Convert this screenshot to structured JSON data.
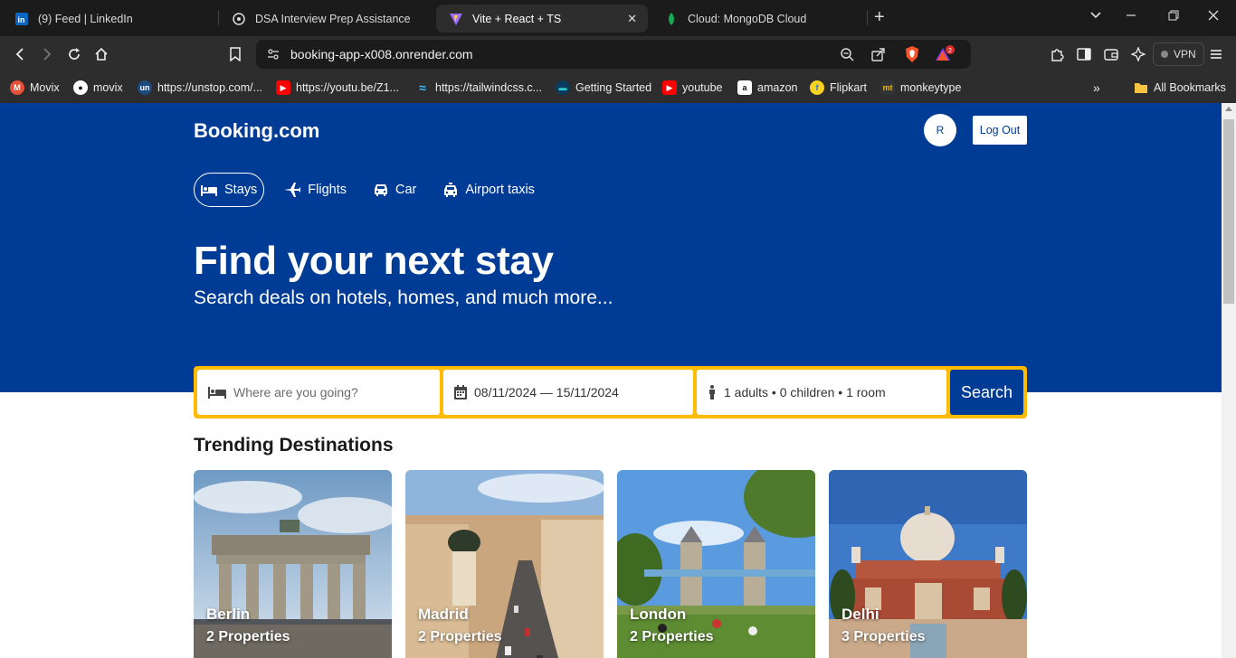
{
  "browser": {
    "tabs": [
      {
        "title": "(9) Feed | LinkedIn",
        "icon": "linkedin-icon"
      },
      {
        "title": "DSA Interview Prep Assistance",
        "icon": "openai-icon"
      },
      {
        "title": "Vite + React + TS",
        "icon": "vite-icon",
        "active": true
      },
      {
        "title": "Cloud: MongoDB Cloud",
        "icon": "mongodb-leaf-icon"
      }
    ],
    "url": "booking-app-x008.onrender.com",
    "vpn_label": "VPN",
    "rewards_badge": "2",
    "bookmarks": [
      {
        "label": "Movix",
        "icon": "movix-icon"
      },
      {
        "label": "movix",
        "icon": "github-icon"
      },
      {
        "label": "https://unstop.com/...",
        "icon": "unstop-icon"
      },
      {
        "label": "https://youtu.be/Z1...",
        "icon": "youtube-icon"
      },
      {
        "label": "https://tailwindcss.c...",
        "icon": "tailwind-icon"
      },
      {
        "label": "Getting Started",
        "icon": "getting-started-icon"
      },
      {
        "label": "youtube",
        "icon": "youtube-icon"
      },
      {
        "label": "amazon",
        "icon": "amazon-icon"
      },
      {
        "label": "Flipkart",
        "icon": "flipkart-icon"
      },
      {
        "label": "monkeytype",
        "icon": "monkeytype-icon"
      }
    ],
    "all_bookmarks_label": "All Bookmarks"
  },
  "header": {
    "logo": "Booking.com",
    "avatar_initial": "R",
    "logout_label": "Log Out"
  },
  "nav": [
    {
      "label": "Stays",
      "icon": "bed-icon",
      "active": true
    },
    {
      "label": "Flights",
      "icon": "plane-icon"
    },
    {
      "label": "Car",
      "icon": "car-icon"
    },
    {
      "label": "Airport taxis",
      "icon": "taxi-icon"
    }
  ],
  "hero": {
    "title": "Find your next stay",
    "subtitle": "Search deals on hotels, homes, and much more..."
  },
  "search": {
    "destination_placeholder": "Where are you going?",
    "date_range": "08/11/2024 — 15/11/2024",
    "guests": "1 adults • 0 children • 1 room",
    "button_label": "Search"
  },
  "trending": {
    "title": "Trending Destinations",
    "cards": [
      {
        "city": "Berlin",
        "properties": "2 Properties"
      },
      {
        "city": "Madrid",
        "properties": "2 Properties"
      },
      {
        "city": "London",
        "properties": "2 Properties"
      },
      {
        "city": "Delhi",
        "properties": "3 Properties"
      }
    ]
  },
  "colors": {
    "brand_blue": "#003b95",
    "search_border": "#febb02"
  }
}
